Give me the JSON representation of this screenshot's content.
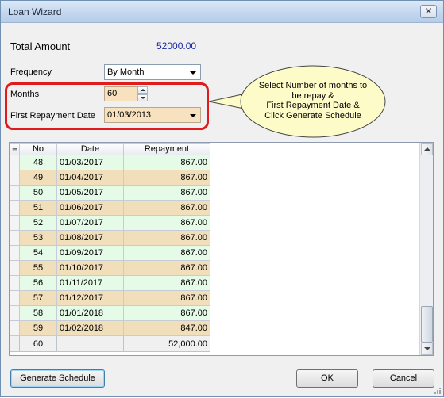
{
  "window": {
    "title": "Loan Wizard",
    "close_glyph": "✕"
  },
  "form": {
    "total_label": "Total Amount",
    "total_value": "52000.00",
    "frequency_label": "Frequency",
    "frequency_value": "By Month",
    "months_label": "Months",
    "months_value": "60",
    "first_date_label": "First Repayment Date",
    "first_date_value": "01/03/2013"
  },
  "callout": {
    "lines": [
      "Select Number of months to",
      "be repay &",
      "First Repayment Date &",
      "Click Generate Schedule"
    ]
  },
  "grid": {
    "columns": [
      "No",
      "Date",
      "Repayment"
    ],
    "rows": [
      {
        "no": "48",
        "date": "01/03/2017",
        "repayment": "867.00"
      },
      {
        "no": "49",
        "date": "01/04/2017",
        "repayment": "867.00"
      },
      {
        "no": "50",
        "date": "01/05/2017",
        "repayment": "867.00"
      },
      {
        "no": "51",
        "date": "01/06/2017",
        "repayment": "867.00"
      },
      {
        "no": "52",
        "date": "01/07/2017",
        "repayment": "867.00"
      },
      {
        "no": "53",
        "date": "01/08/2017",
        "repayment": "867.00"
      },
      {
        "no": "54",
        "date": "01/09/2017",
        "repayment": "867.00"
      },
      {
        "no": "55",
        "date": "01/10/2017",
        "repayment": "867.00"
      },
      {
        "no": "56",
        "date": "01/11/2017",
        "repayment": "867.00"
      },
      {
        "no": "57",
        "date": "01/12/2017",
        "repayment": "867.00"
      },
      {
        "no": "58",
        "date": "01/01/2018",
        "repayment": "867.00"
      },
      {
        "no": "59",
        "date": "01/02/2018",
        "repayment": "847.00"
      }
    ],
    "footer": {
      "count": "60",
      "total": "52,000.00"
    },
    "row_colors": {
      "even": "#e5fbe7",
      "odd": "#f1deba"
    }
  },
  "buttons": {
    "generate": "Generate Schedule",
    "ok": "OK",
    "cancel": "Cancel"
  },
  "colors": {
    "highlight": "#e01b1b",
    "callout_fill": "#fdfcc8",
    "amount": "#1a2aa0"
  }
}
